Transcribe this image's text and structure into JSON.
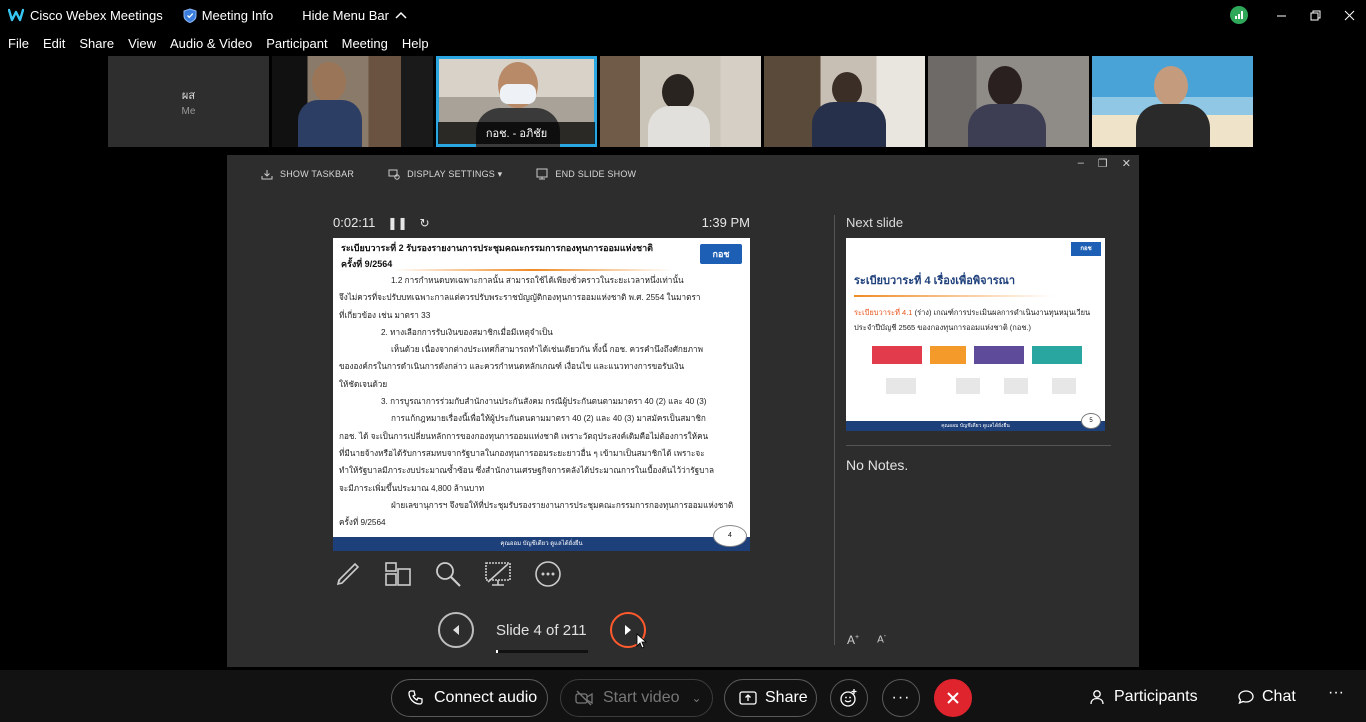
{
  "titlebar": {
    "app_name": "Cisco Webex Meetings",
    "meeting_info": "Meeting Info",
    "hide_menu_bar": "Hide Menu Bar"
  },
  "menu": [
    "File",
    "Edit",
    "Share",
    "View",
    "Audio & Video",
    "Participant",
    "Meeting",
    "Help"
  ],
  "participants": {
    "me_initials": "ผส",
    "me_label": "Me",
    "active_speaker_name": "กอช. - อภิชัย"
  },
  "presenter": {
    "toolbar": {
      "show_taskbar": "SHOW TASKBAR",
      "display_settings": "DISPLAY SETTINGS ▾",
      "end_slide_show": "END SLIDE SHOW"
    },
    "elapsed": "0:02:11",
    "clock": "1:39 PM",
    "current_slide": {
      "title_line1": "ระเบียบวาระที่ 2 รับรองรายงานการประชุมคณะกรรมการกองทุนการออมแห่งชาติ",
      "title_line2": "ครั้งที่ 9/2564",
      "logo": "กอช",
      "body": [
        "1.2       การกำหนดบทเฉพาะกาลนั้น สามารถใช้ได้เพียงชั่วคราวในระยะเวลาหนึ่งเท่านั้น",
        "จึงไม่ควรที่จะปรับบทเฉพาะกาลแต่ควรปรับพระราชบัญญัติกองทุนการออมแห่งชาติ พ.ศ. 2554 ในมาตรา",
        "ที่เกี่ยวข้อง เช่น มาตรา 33",
        "2. ทางเลือกการรับเงินของสมาชิกเมื่อมีเหตุจำเป็น",
        "เห็นด้วย เนื่องจากต่างประเทศก็สามารถทำได้เช่นเดียวกัน ทั้งนี้ กอช. ควรคำนึงถึงศักยภาพ",
        "ขององค์กรในการดำเนินการดังกล่าว และควรกำหนดหลักเกณฑ์ เงื่อนไข และแนวทางการขอรับเงิน",
        "ให้ชัดเจนด้วย",
        "3. การบูรณาการร่วมกับสำนักงานประกันสังคม กรณีผู้ประกันตนตามมาตรา 40 (2) และ 40 (3)",
        "การแก้กฎหมายเรื่องนี้เพื่อให้ผู้ประกันตนตามมาตรา 40 (2) และ 40 (3) มาสมัครเป็นสมาชิก",
        "กอช. ได้ จะเป็นการเปลี่ยนหลักการของกองทุนการออมแห่งชาติ เพราะวัตถุประสงค์เดิมคือไม่ต้องการให้คน",
        "ที่มีนายจ้างหรือได้รับการสมทบจากรัฐบาลในกองทุนการออมระยะยาวอื่น ๆ เข้ามาเป็นสมาชิกได้ เพราะจะ",
        "ทำให้รัฐบาลมีภาระงบประมาณซ้ำซ้อน ซึ่งสำนักงานเศรษฐกิจการคลังได้ประมาณการในเบื้องต้นไว้ว่ารัฐบาล",
        "จะมีภาระเพิ่มขึ้นประมาณ 4,800 ล้านบาท",
        "ฝ่ายเลขานุการฯ จึงขอให้ที่ประชุมรับรองรายงานการประชุมคณะกรรมการกองทุนการออมแห่งชาติ",
        "ครั้งที่ 9/2564"
      ],
      "footer": "คุณออม บัญชีเดียว ดูแลได้ยั่งยืน",
      "page": "4"
    },
    "slide_counter": "Slide 4 of 211",
    "progress": 0.019,
    "next_label": "Next slide",
    "next_slide": {
      "logo": "กอช",
      "title": "ระเบียบวาระที่ 4 เรื่องเพื่อพิจารณา",
      "agenda_prefix": "ระเบียบวาระที่ 4.1",
      "agenda_text": " (ร่าง) เกณฑ์การประเมินผลการดำเนินงานทุนหมุนเวียน",
      "agenda_line2": "ประจำปีบัญชี 2565 ของกองทุนการออมแห่งชาติ (กอช.)",
      "footer": "คุณออม บัญชีเดียว ดูแลได้ยั่งยืน",
      "page": "5"
    },
    "notes": "No Notes."
  },
  "bottombar": {
    "connect_audio": "Connect audio",
    "start_video": "Start video",
    "share": "Share",
    "participants": "Participants",
    "chat": "Chat"
  },
  "colors": {
    "accent_blue": "#2aa6e0",
    "next_button": "#ff5a2d",
    "leave_red": "#e0242e",
    "slide_navy": "#1d3f7a",
    "slide_orange": "#f08a24"
  }
}
